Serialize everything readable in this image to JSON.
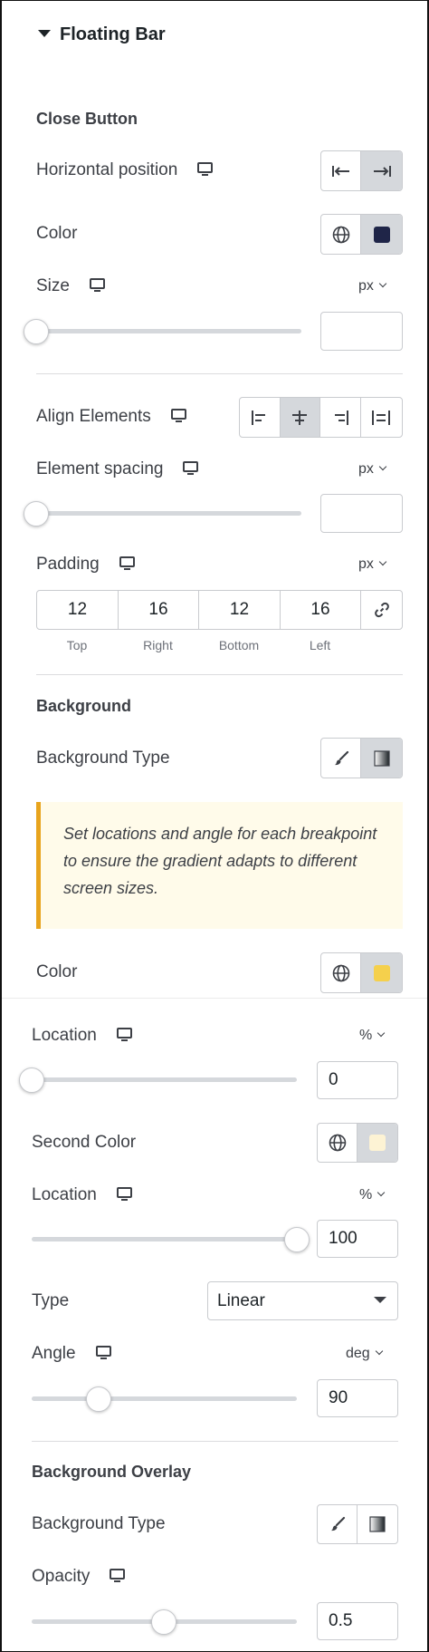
{
  "panel": {
    "title": "Floating Bar"
  },
  "close_button": {
    "section_title": "Close Button",
    "horizontal_position": {
      "label": "Horizontal position",
      "active": "right"
    },
    "color": {
      "label": "Color",
      "value": "#1f2548"
    },
    "size": {
      "label": "Size",
      "unit": "px",
      "slider_level": 0,
      "value": ""
    }
  },
  "align_elements": {
    "label": "Align Elements",
    "active": "center"
  },
  "element_spacing": {
    "label": "Element spacing",
    "unit": "px",
    "slider_level": 0,
    "value": ""
  },
  "padding": {
    "label": "Padding",
    "unit": "px",
    "values": {
      "top": "12",
      "right": "16",
      "bottom": "12",
      "left": "16"
    },
    "sublabels": {
      "top": "Top",
      "right": "Right",
      "bottom": "Bottom",
      "left": "Left"
    }
  },
  "background": {
    "section_title": "Background",
    "type_label": "Background Type",
    "type_active": "gradient",
    "notice": "Set locations and angle for each breakpoint to ensure the gradient adapts to different screen sizes.",
    "color": {
      "label": "Color",
      "value": "#f5d04c"
    },
    "location": {
      "label": "Location",
      "unit": "%",
      "slider_level": 0,
      "value": "0"
    },
    "second_color": {
      "label": "Second Color",
      "value": "#fdf3d4"
    },
    "second_location": {
      "label": "Location",
      "unit": "%",
      "slider_level": 100,
      "value": "100"
    },
    "type": {
      "label": "Type",
      "value": "Linear"
    },
    "angle": {
      "label": "Angle",
      "unit": "deg",
      "slider_level": 90,
      "max": 360,
      "value": "90"
    }
  },
  "background_overlay": {
    "section_title": "Background Overlay",
    "type_label": "Background Type",
    "opacity": {
      "label": "Opacity",
      "slider_level": 0.5,
      "value": "0.5"
    }
  },
  "colors": {
    "accent_notice": "#e8a41d",
    "active_toggle": "#d5d8dc"
  }
}
